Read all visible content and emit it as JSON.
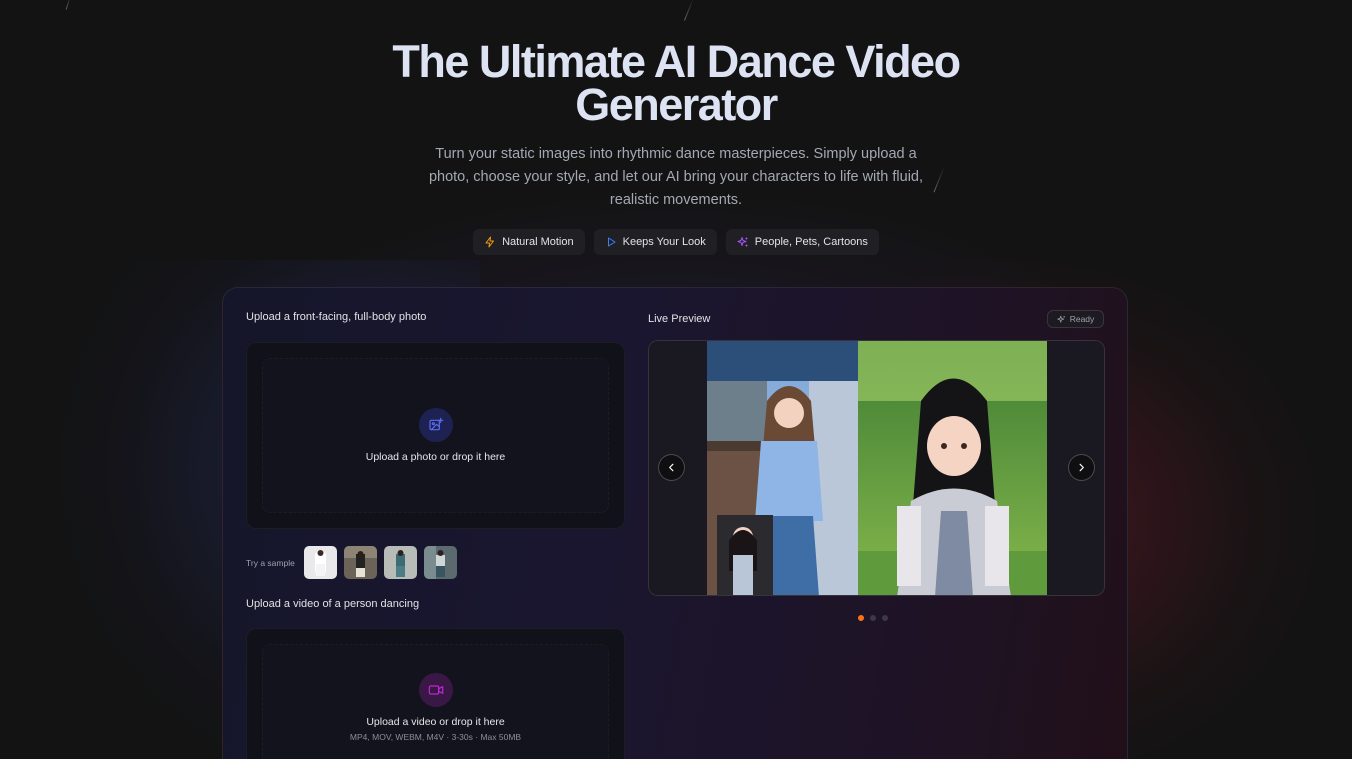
{
  "hero": {
    "title_line1": "The Ultimate AI Dance Video",
    "title_line2": "Generator",
    "subtitle": "Turn your static images into rhythmic dance masterpieces. Simply upload a photo, choose your style, and let our AI bring your characters to life with fluid, realistic movements."
  },
  "features": [
    {
      "label": "Natural Motion",
      "icon": "lightning-icon",
      "color": "#f59e0b"
    },
    {
      "label": "Keeps Your Look",
      "icon": "play-icon",
      "color": "#3b82f6"
    },
    {
      "label": "People, Pets, Cartoons",
      "icon": "sparkles-icon",
      "color": "#a855f7"
    }
  ],
  "photo_upload": {
    "label": "Upload a front-facing, full-body photo",
    "drop_text": "Upload a photo or drop it here",
    "icon": "image-plus-icon",
    "icon_color": "#4f46e5"
  },
  "samples": {
    "label": "Try a sample",
    "count": 4
  },
  "video_upload": {
    "label": "Upload a video of a person dancing",
    "drop_text": "Upload a video or drop it here",
    "hint": "MP4, MOV, WEBM, M4V · 3-30s · Max 50MB",
    "icon": "video-icon",
    "icon_color": "#c026d3"
  },
  "preview": {
    "label": "Live Preview",
    "status": "Ready",
    "slides": 3,
    "active_slide": 1,
    "accent": "#f97316"
  }
}
